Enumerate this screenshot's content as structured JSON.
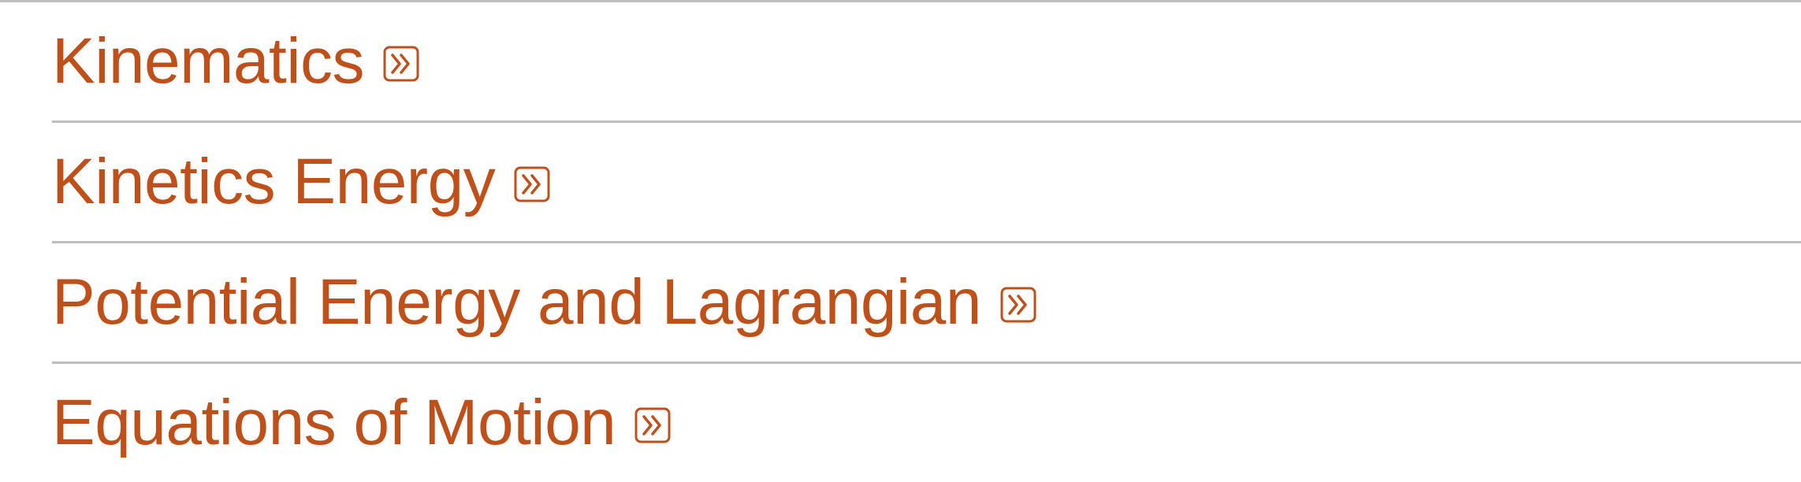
{
  "colors": {
    "link": "#c0501a",
    "divider": "#bfbfbf",
    "background": "#ffffff"
  },
  "topics": {
    "items": [
      {
        "label": "Kinematics",
        "icon": "double-chevron-right-icon"
      },
      {
        "label": "Kinetics Energy",
        "icon": "double-chevron-right-icon"
      },
      {
        "label": "Potential Energy and Lagrangian",
        "icon": "double-chevron-right-icon"
      },
      {
        "label": "Equations of Motion",
        "icon": "double-chevron-right-icon"
      }
    ]
  }
}
